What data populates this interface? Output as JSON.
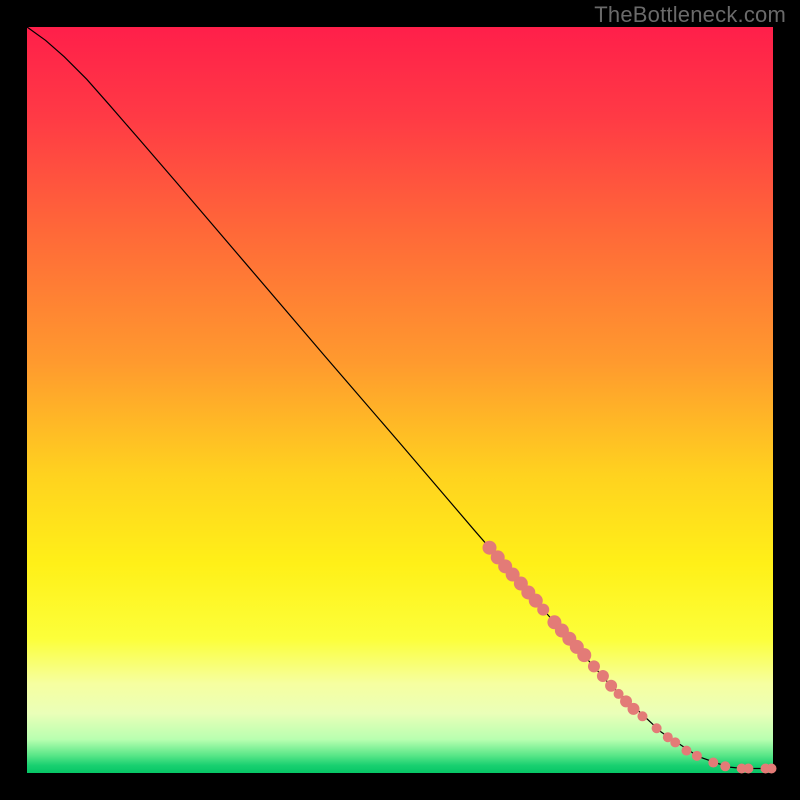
{
  "watermark": "TheBottleneck.com",
  "chart_data": {
    "type": "line",
    "title": "",
    "xlabel": "",
    "ylabel": "",
    "xlim": [
      0,
      100
    ],
    "ylim": [
      0,
      100
    ],
    "grid": false,
    "legend": false,
    "background": {
      "type": "vertical-gradient",
      "stops": [
        {
          "pos": 0.0,
          "color": "#ff1f4a"
        },
        {
          "pos": 0.12,
          "color": "#ff3a45"
        },
        {
          "pos": 0.28,
          "color": "#ff6a38"
        },
        {
          "pos": 0.45,
          "color": "#ff9a2e"
        },
        {
          "pos": 0.6,
          "color": "#ffd21f"
        },
        {
          "pos": 0.72,
          "color": "#fff018"
        },
        {
          "pos": 0.82,
          "color": "#fcff3a"
        },
        {
          "pos": 0.88,
          "color": "#f6ffa0"
        },
        {
          "pos": 0.92,
          "color": "#eaffb8"
        },
        {
          "pos": 0.955,
          "color": "#b8ffb0"
        },
        {
          "pos": 0.975,
          "color": "#5fe88a"
        },
        {
          "pos": 0.99,
          "color": "#18d070"
        },
        {
          "pos": 1.0,
          "color": "#06c566"
        }
      ]
    },
    "series": [
      {
        "name": "curve",
        "color": "#000000",
        "width": 1.2,
        "points": [
          {
            "x": 0.0,
            "y": 100.0
          },
          {
            "x": 2.5,
            "y": 98.2
          },
          {
            "x": 5.0,
            "y": 96.0
          },
          {
            "x": 8.0,
            "y": 93.0
          },
          {
            "x": 11.0,
            "y": 89.6
          },
          {
            "x": 15.0,
            "y": 85.0
          },
          {
            "x": 20.0,
            "y": 79.2
          },
          {
            "x": 30.0,
            "y": 67.5
          },
          {
            "x": 40.0,
            "y": 55.8
          },
          {
            "x": 50.0,
            "y": 44.2
          },
          {
            "x": 60.0,
            "y": 32.5
          },
          {
            "x": 70.0,
            "y": 21.0
          },
          {
            "x": 78.0,
            "y": 12.0
          },
          {
            "x": 85.0,
            "y": 5.5
          },
          {
            "x": 90.0,
            "y": 2.2
          },
          {
            "x": 94.0,
            "y": 0.8
          },
          {
            "x": 96.0,
            "y": 0.6
          },
          {
            "x": 97.5,
            "y": 0.6
          },
          {
            "x": 100.0,
            "y": 0.6
          }
        ]
      }
    ],
    "marker_color": "#e37b77",
    "marker_radius_major": 7,
    "marker_radius_minor": 5,
    "markers": [
      {
        "x": 62.0,
        "y": 30.2,
        "r": 7
      },
      {
        "x": 63.1,
        "y": 28.9,
        "r": 7
      },
      {
        "x": 64.1,
        "y": 27.7,
        "r": 7
      },
      {
        "x": 65.1,
        "y": 26.6,
        "r": 7
      },
      {
        "x": 66.2,
        "y": 25.4,
        "r": 7
      },
      {
        "x": 67.2,
        "y": 24.2,
        "r": 7
      },
      {
        "x": 68.2,
        "y": 23.1,
        "r": 7
      },
      {
        "x": 69.2,
        "y": 21.9,
        "r": 6
      },
      {
        "x": 70.7,
        "y": 20.2,
        "r": 7
      },
      {
        "x": 71.7,
        "y": 19.1,
        "r": 7
      },
      {
        "x": 72.7,
        "y": 18.0,
        "r": 7
      },
      {
        "x": 73.7,
        "y": 16.9,
        "r": 7
      },
      {
        "x": 74.7,
        "y": 15.8,
        "r": 7
      },
      {
        "x": 76.0,
        "y": 14.3,
        "r": 6
      },
      {
        "x": 77.2,
        "y": 13.0,
        "r": 6
      },
      {
        "x": 78.3,
        "y": 11.7,
        "r": 6
      },
      {
        "x": 79.3,
        "y": 10.6,
        "r": 5
      },
      {
        "x": 80.3,
        "y": 9.6,
        "r": 6
      },
      {
        "x": 81.3,
        "y": 8.6,
        "r": 6
      },
      {
        "x": 82.5,
        "y": 7.6,
        "r": 5
      },
      {
        "x": 84.4,
        "y": 6.0,
        "r": 5
      },
      {
        "x": 85.9,
        "y": 4.8,
        "r": 5
      },
      {
        "x": 86.9,
        "y": 4.1,
        "r": 5
      },
      {
        "x": 88.4,
        "y": 3.0,
        "r": 5
      },
      {
        "x": 89.8,
        "y": 2.3,
        "r": 5
      },
      {
        "x": 92.0,
        "y": 1.4,
        "r": 5
      },
      {
        "x": 93.6,
        "y": 0.9,
        "r": 5
      },
      {
        "x": 95.8,
        "y": 0.6,
        "r": 5
      },
      {
        "x": 96.7,
        "y": 0.6,
        "r": 5
      },
      {
        "x": 99.0,
        "y": 0.6,
        "r": 5
      },
      {
        "x": 99.8,
        "y": 0.6,
        "r": 5
      }
    ]
  }
}
